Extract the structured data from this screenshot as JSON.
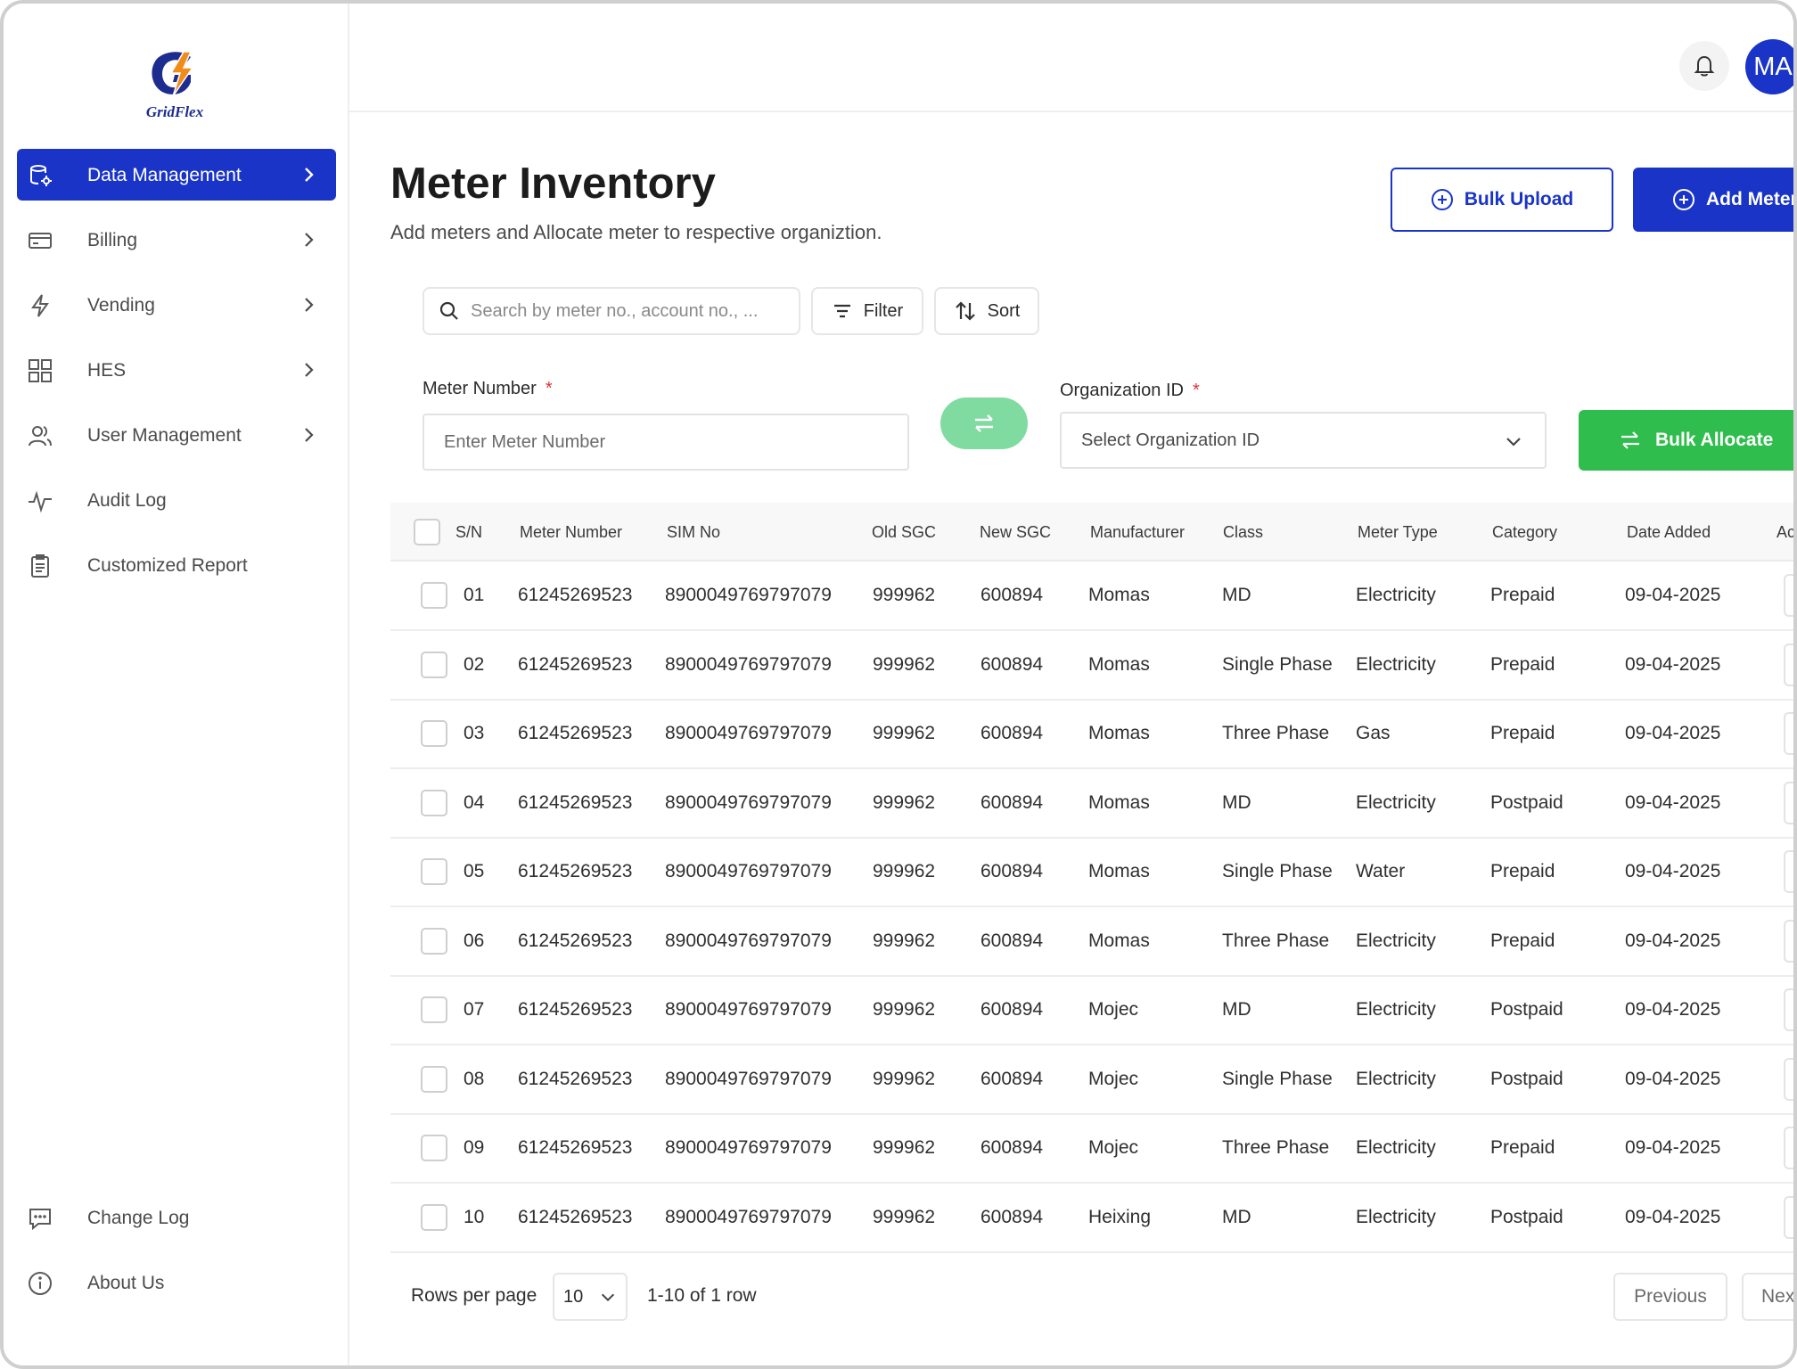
{
  "brand": {
    "logo_text": "GridFlex"
  },
  "sidebar": {
    "items": [
      {
        "label": "Data Management",
        "icon": "database-settings-icon"
      },
      {
        "label": "Billing",
        "icon": "credit-card-icon"
      },
      {
        "label": "Vending",
        "icon": "lightning-icon"
      },
      {
        "label": "HES",
        "icon": "grid-icon"
      },
      {
        "label": "User Management",
        "icon": "users-icon"
      },
      {
        "label": "Audit Log",
        "icon": "pulse-icon"
      },
      {
        "label": "Customized Report",
        "icon": "clipboard-icon"
      }
    ],
    "bottom_items": [
      {
        "label": "Change Log",
        "icon": "chat-icon"
      },
      {
        "label": "About Us",
        "icon": "info-icon"
      }
    ]
  },
  "header": {
    "avatar_initials": "MA"
  },
  "page": {
    "title": "Meter Inventory",
    "subtitle": "Add meters and Allocate meter to respective organiztion.",
    "bulk_upload_label": "Bulk Upload",
    "add_meter_label": "Add Meter"
  },
  "toolbar": {
    "search_placeholder": "Search by meter no., account no., ...",
    "filter_label": "Filter",
    "sort_label": "Sort"
  },
  "allocate": {
    "meter_number_label": "Meter Number",
    "meter_number_placeholder": "Enter Meter Number",
    "org_id_label": "Organization ID",
    "org_id_placeholder": "Select Organization ID",
    "required_mark": "*",
    "bulk_allocate_label": "Bulk Allocate"
  },
  "table": {
    "headers": [
      "S/N",
      "Meter Number",
      "SIM No",
      "Old SGC",
      "New SGC",
      "Manufacturer",
      "Class",
      "Meter Type",
      "Category",
      "Date Added",
      "Act"
    ],
    "rows": [
      [
        "01",
        "61245269523",
        "8900049769797079",
        "999962",
        "600894",
        "Momas",
        "MD",
        "Electricity",
        "Prepaid",
        "09-04-2025"
      ],
      [
        "02",
        "61245269523",
        "8900049769797079",
        "999962",
        "600894",
        "Momas",
        "Single Phase",
        "Electricity",
        "Prepaid",
        "09-04-2025"
      ],
      [
        "03",
        "61245269523",
        "8900049769797079",
        "999962",
        "600894",
        "Momas",
        "Three Phase",
        "Gas",
        "Prepaid",
        "09-04-2025"
      ],
      [
        "04",
        "61245269523",
        "8900049769797079",
        "999962",
        "600894",
        "Momas",
        "MD",
        "Electricity",
        "Postpaid",
        "09-04-2025"
      ],
      [
        "05",
        "61245269523",
        "8900049769797079",
        "999962",
        "600894",
        "Momas",
        "Single Phase",
        "Water",
        "Prepaid",
        "09-04-2025"
      ],
      [
        "06",
        "61245269523",
        "8900049769797079",
        "999962",
        "600894",
        "Momas",
        "Three Phase",
        "Electricity",
        "Prepaid",
        "09-04-2025"
      ],
      [
        "07",
        "61245269523",
        "8900049769797079",
        "999962",
        "600894",
        "Mojec",
        "MD",
        "Electricity",
        "Postpaid",
        "09-04-2025"
      ],
      [
        "08",
        "61245269523",
        "8900049769797079",
        "999962",
        "600894",
        "Mojec",
        "Single Phase",
        "Electricity",
        "Postpaid",
        "09-04-2025"
      ],
      [
        "09",
        "61245269523",
        "8900049769797079",
        "999962",
        "600894",
        "Mojec",
        "Three Phase",
        "Electricity",
        "Prepaid",
        "09-04-2025"
      ],
      [
        "10",
        "61245269523",
        "8900049769797079",
        "999962",
        "600894",
        "Heixing",
        "MD",
        "Electricity",
        "Postpaid",
        "09-04-2025"
      ]
    ]
  },
  "pagination": {
    "rows_per_page_label": "Rows per page",
    "rows_per_page_value": "10",
    "range_text": "1-10 of 1 row",
    "previous_label": "Previous",
    "next_label": "Next"
  },
  "colors": {
    "primary": "#1a34c8",
    "success": "#2fbd4d",
    "swap_button": "#7fdba0",
    "required": "#e03131"
  }
}
